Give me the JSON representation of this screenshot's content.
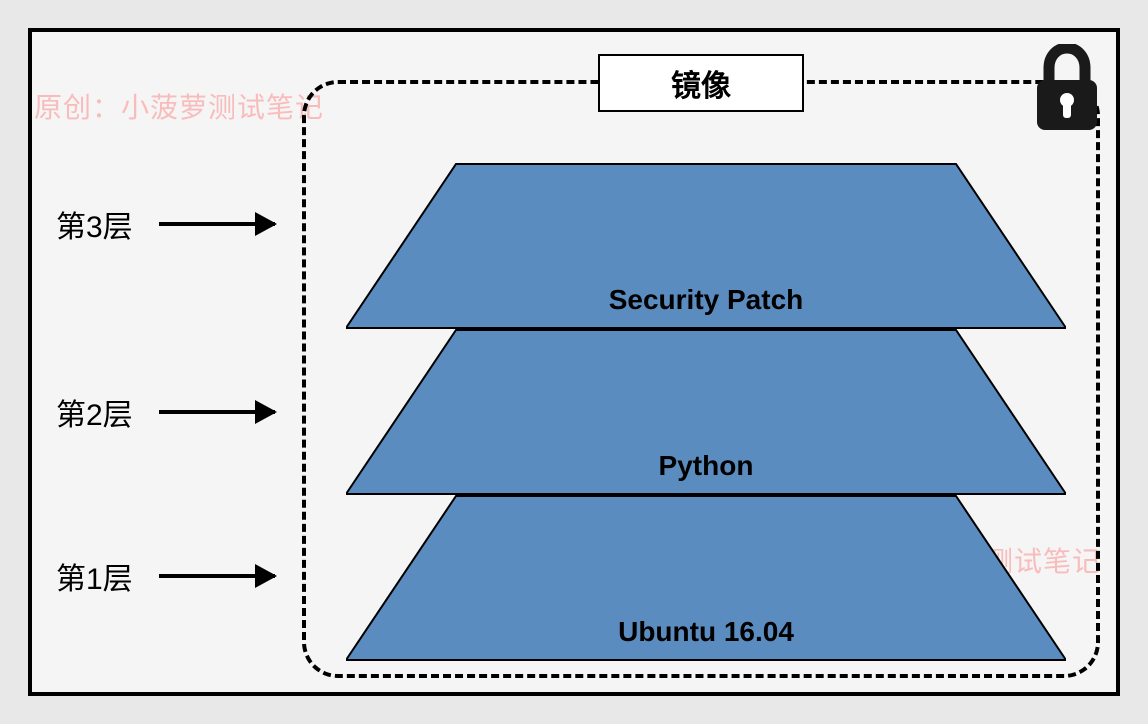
{
  "diagram": {
    "title": "镜像",
    "layers": [
      {
        "index": 1,
        "label": "第1层",
        "content": "Ubuntu 16.04"
      },
      {
        "index": 2,
        "label": "第2层",
        "content": "Python"
      },
      {
        "index": 3,
        "label": "第3层",
        "content": "Security Patch"
      }
    ],
    "icon": "lock-icon",
    "colors": {
      "trapezoid_fill": "#5b8cc0",
      "trapezoid_stroke": "#000000",
      "watermark": "rgba(255,120,120,0.45)"
    }
  },
  "watermark": "原创：小菠萝测试笔记"
}
